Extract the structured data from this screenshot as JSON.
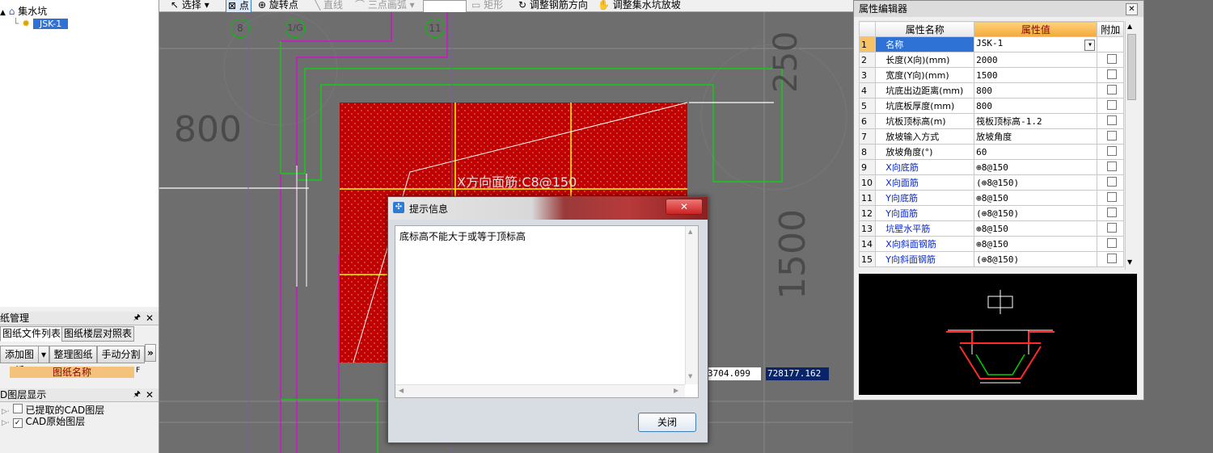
{
  "tree": {
    "root_label": "集水坑",
    "child_label": "JSK-1"
  },
  "toolbar": {
    "select": "选择",
    "point": "点",
    "rotate_point": "旋转点",
    "line": "直线",
    "arc": "三点画弧",
    "rect": "矩形",
    "adjust_rebar": "调整钢筋方向",
    "adjust_slope": "调整集水坑放坡"
  },
  "drawing_panel": {
    "title": "纸管理",
    "tab_files": "图纸文件列表",
    "tab_floors": "图纸楼层对照表",
    "btn_add": "添加图纸",
    "btn_arrange": "整理图纸",
    "btn_split": "手动分割",
    "more": "»",
    "col_header": "图纸名称",
    "col_extra": "F"
  },
  "layer_panel": {
    "title": "D图层显示",
    "item_extracted": "已提取的CAD图层",
    "item_original": "CAD原始图层"
  },
  "cad": {
    "axis_8": "8",
    "axis_1g": "1/G",
    "axis_11": "11",
    "dim_800": "800",
    "dim_250": "250",
    "dim_1500": "1500",
    "rebar_label": "X方向面筋:C8@150",
    "coord_x": "3704.099",
    "coord_y": "728177.162"
  },
  "property_editor": {
    "title": "属性编辑器",
    "col_name": "属性名称",
    "col_value": "属性值",
    "col_extra": "附加",
    "rows": [
      {
        "num": "1",
        "name": "名称",
        "value": "JSK-1",
        "blue": false
      },
      {
        "num": "2",
        "name": "长度(X向)(mm)",
        "value": "2000",
        "blue": false
      },
      {
        "num": "3",
        "name": "宽度(Y向)(mm)",
        "value": "1500",
        "blue": false
      },
      {
        "num": "4",
        "name": "坑底出边距离(mm)",
        "value": "800",
        "blue": false
      },
      {
        "num": "5",
        "name": "坑底板厚度(mm)",
        "value": "800",
        "blue": false
      },
      {
        "num": "6",
        "name": "坑板顶标高(m)",
        "value": "筏板顶标高-1.2",
        "blue": false
      },
      {
        "num": "7",
        "name": "放坡输入方式",
        "value": "放坡角度",
        "blue": false
      },
      {
        "num": "8",
        "name": "放坡角度(°)",
        "value": "60",
        "blue": false
      },
      {
        "num": "9",
        "name": "X向底筋",
        "value": "⊕8@150",
        "blue": true
      },
      {
        "num": "10",
        "name": "X向面筋",
        "value": "(⊕8@150)",
        "blue": true
      },
      {
        "num": "11",
        "name": "Y向底筋",
        "value": "⊕8@150",
        "blue": true
      },
      {
        "num": "12",
        "name": "Y向面筋",
        "value": "(⊕8@150)",
        "blue": true
      },
      {
        "num": "13",
        "name": "坑壁水平筋",
        "value": "⊕8@150",
        "blue": true
      },
      {
        "num": "14",
        "name": "X向斜面钢筋",
        "value": "⊕8@150",
        "blue": true
      },
      {
        "num": "15",
        "name": "Y向斜面钢筋",
        "value": "(⊕8@150)",
        "blue": true
      }
    ]
  },
  "dialog": {
    "title": "提示信息",
    "message": "底标高不能大于或等于顶标高",
    "close_label": "关闭",
    "x_glyph": "✕"
  },
  "colors": {
    "pit_fill": "#c00000",
    "cad_bg": "#6e6e6e",
    "green_line": "#00e000",
    "magenta_line": "#e000e0",
    "yellow_line": "#ffff00",
    "arrow_red": "#e8201a"
  }
}
